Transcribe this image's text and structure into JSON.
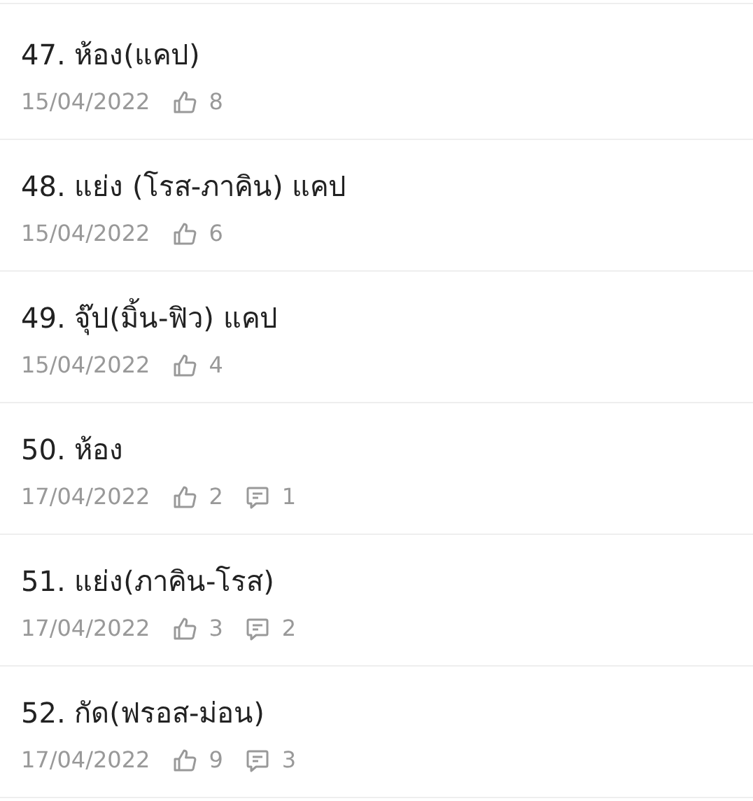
{
  "posts": [
    {
      "title": "47. ห้อง(แคป)",
      "date": "15/04/2022",
      "likes": "8"
    },
    {
      "title": "48. แย่ง (โรส-ภาคิน) แคป",
      "date": "15/04/2022",
      "likes": "6"
    },
    {
      "title": "49. จุ๊ป(มิ้น-ฟิว) แคป",
      "date": "15/04/2022",
      "likes": "4"
    },
    {
      "title": "50. ห้อง",
      "date": "17/04/2022",
      "likes": "2",
      "comments": "1"
    },
    {
      "title": "51. แย่ง(ภาคิน-โรส)",
      "date": "17/04/2022",
      "likes": "3",
      "comments": "2"
    },
    {
      "title": "52. กัด(ฟรอส-ม่อน)",
      "date": "17/04/2022",
      "likes": "9",
      "comments": "3"
    }
  ]
}
